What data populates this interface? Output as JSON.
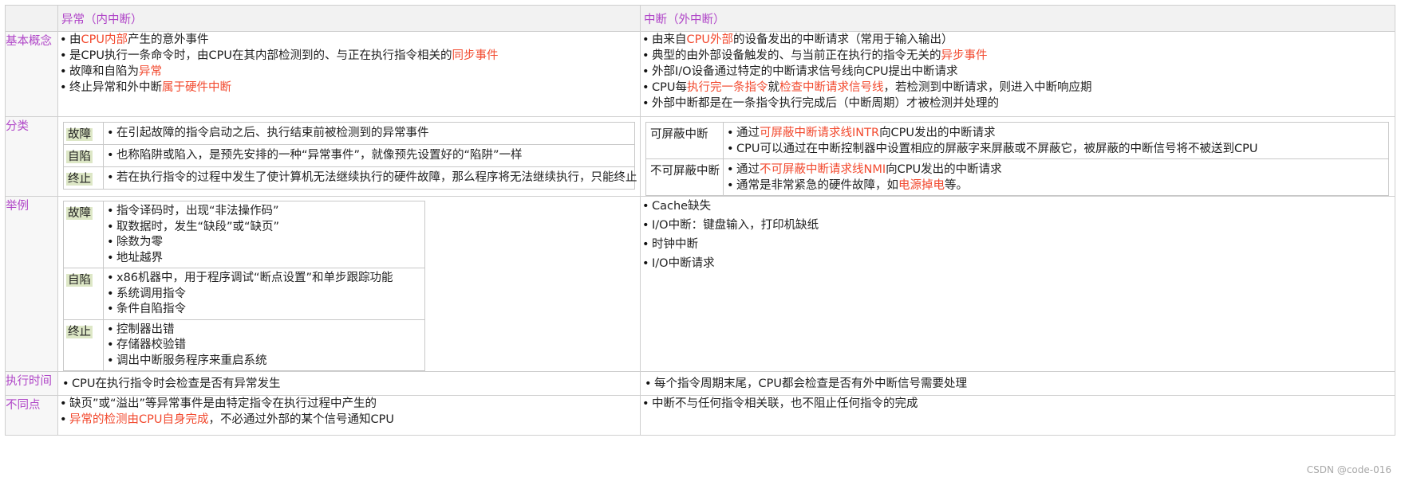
{
  "header": {
    "col1": "异常（内中断）",
    "col2": "中断（外中断）"
  },
  "rows": {
    "basic": {
      "label": "基本概念",
      "exception": [
        [
          {
            "t": "由"
          },
          {
            "t": "CPU内部",
            "red": true
          },
          {
            "t": "产生的意外事件"
          }
        ],
        [
          {
            "t": "是CPU执行一条命令时，由CPU在其内部检测到的、与正在执行指令相关的"
          },
          {
            "t": "同步事件",
            "red": true
          }
        ],
        [
          {
            "t": "故障和自陷为"
          },
          {
            "t": "异常",
            "red": true
          }
        ],
        [
          {
            "t": "终止异常和外中断"
          },
          {
            "t": "属于硬件中断",
            "red": true
          }
        ]
      ],
      "interrupt": [
        [
          {
            "t": "由来自"
          },
          {
            "t": "CPU外部",
            "red": true
          },
          {
            "t": "的设备发出的中断请求（常用于输入输出）"
          }
        ],
        [
          {
            "t": "典型的由外部设备触发的、与当前正在执行的指令无关的"
          },
          {
            "t": "异步事件",
            "red": true
          }
        ],
        [
          {
            "t": "外部I/O设备通过特定的中断请求信号线向CPU提出中断请求"
          }
        ],
        [
          {
            "t": "CPU每"
          },
          {
            "t": "执行完一条指令",
            "red": true
          },
          {
            "t": "就"
          },
          {
            "t": "检查中断请求信号线",
            "red": true
          },
          {
            "t": "，若检测到中断请求，则进入中断响应期"
          }
        ],
        [
          {
            "t": "外部中断都是在一条指令执行完成后（中断周期）才被检测并处理的"
          }
        ]
      ]
    },
    "classify": {
      "label": "分类",
      "exception": [
        {
          "tag": "故障",
          "items": [
            "在引起故障的指令启动之后、执行结束前被检测到的异常事件"
          ]
        },
        {
          "tag": "自陷",
          "items": [
            "也称陷阱或陷入，是预先安排的一种“异常事件”，就像预先设置好的“陷阱”一样"
          ]
        },
        {
          "tag": "终止",
          "items": [
            "若在执行指令的过程中发生了使计算机无法继续执行的硬件故障，那么程序将无法继续执行，只能终止"
          ]
        }
      ],
      "interrupt": [
        {
          "tag": "可屏蔽中断",
          "items": [
            [
              {
                "t": "通过"
              },
              {
                "t": "可屏蔽中断请求线INTR",
                "red": true
              },
              {
                "t": "向CPU发出的中断请求"
              }
            ],
            [
              {
                "t": "CPU可以通过在中断控制器中设置相应的屏蔽字来屏蔽或不屏蔽它，被屏蔽的中断信号将不被送到CPU"
              }
            ]
          ]
        },
        {
          "tag": "不可屏蔽中断",
          "items": [
            [
              {
                "t": "通过"
              },
              {
                "t": "不可屏蔽中断请求线NMI",
                "red": true
              },
              {
                "t": "向CPU发出的中断请求"
              }
            ],
            [
              {
                "t": "通常是非常紧急的硬件故障，如"
              },
              {
                "t": "电源掉电",
                "red": true
              },
              {
                "t": "等。"
              }
            ]
          ]
        }
      ]
    },
    "examples": {
      "label": "举例",
      "exception": [
        {
          "tag": "故障",
          "items": [
            "指令译码时，出现“非法操作码”",
            "取数据时，发生“缺段”或“缺页”",
            "除数为零",
            "地址越界"
          ]
        },
        {
          "tag": "自陷",
          "items": [
            "x86机器中，用于程序调试“断点设置”和单步跟踪功能",
            "系统调用指令",
            "条件自陷指令"
          ]
        },
        {
          "tag": "终止",
          "items": [
            "控制器出错",
            "存储器校验错",
            "调出中断服务程序来重启系统"
          ]
        }
      ],
      "interrupt": [
        "Cache缺失",
        "I/O中断：键盘输入，打印机缺纸",
        "时钟中断",
        "I/O中断请求"
      ]
    },
    "timing": {
      "label": "执行时间",
      "exception": "CPU在执行指令时会检查是否有异常发生",
      "interrupt": "每个指令周期末尾，CPU都会检查是否有外中断信号需要处理"
    },
    "diff": {
      "label": "不同点",
      "exception": [
        [
          {
            "t": "缺页”或“溢出”等异常事件是由特定指令在执行过程中产生的"
          }
        ],
        [
          {
            "t": "异常的检测由CPU自身完成",
            "red": true
          },
          {
            "t": "，不必通过外部的某个信号通知CPU"
          }
        ]
      ],
      "interrupt": [
        [
          {
            "t": "中断不与任何指令相关联，也不阻止任何指令的完成"
          }
        ]
      ]
    }
  },
  "watermark": "CSDN @code-016"
}
